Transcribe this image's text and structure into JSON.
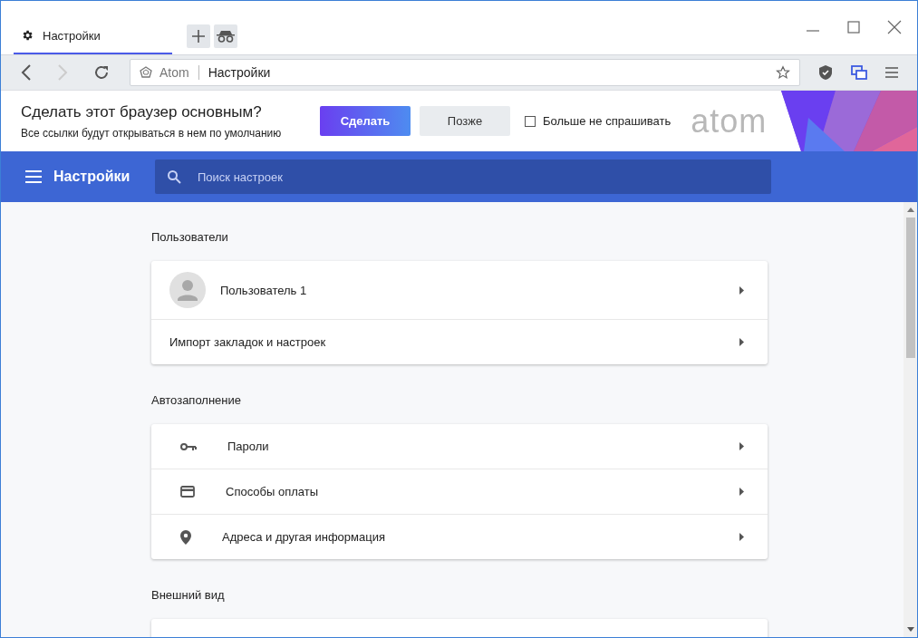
{
  "tabs": [
    {
      "label": "Настройки",
      "selected": true
    }
  ],
  "toolbar": {
    "site": "Atom",
    "address": "Настройки"
  },
  "banner": {
    "title": "Сделать этот браузер основным?",
    "subtitle": "Все ссылки будут открываться в нем по умолчанию",
    "primary": "Сделать",
    "secondary": "Позже",
    "checkbox": {
      "label": "Больше не спрашивать",
      "checked": false
    },
    "logo": "atom"
  },
  "header": {
    "title": "Настройки",
    "search": {
      "placeholder": "Поиск настроек"
    }
  },
  "sections": [
    {
      "title": "Пользователи",
      "rows": [
        {
          "kind": "user",
          "label": "Пользователь 1"
        },
        {
          "kind": "plain",
          "label": "Импорт закладок и настроек"
        }
      ]
    },
    {
      "title": "Автозаполнение",
      "rows": [
        {
          "kind": "password",
          "label": "Пароли"
        },
        {
          "kind": "payment",
          "label": "Способы оплаты"
        },
        {
          "kind": "address",
          "label": "Адреса и другая информация"
        }
      ]
    },
    {
      "title": "Внешний вид"
    }
  ]
}
